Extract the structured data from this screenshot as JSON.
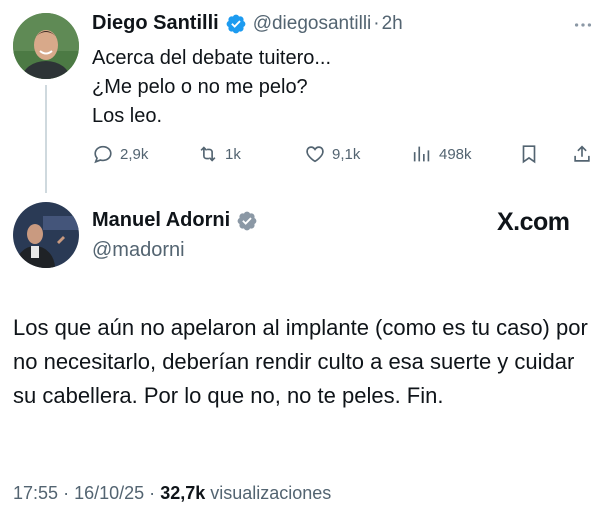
{
  "tweet": {
    "author_name": "Diego Santilli",
    "handle": "@diegosantilli",
    "separator": "·",
    "time": "2h",
    "text": "Acerca del debate tuitero...\n¿Me pelo o no me pelo?\nLos leo.",
    "more_icon": "more-dots-icon",
    "actions": {
      "replies": "2,9k",
      "retweets": "1k",
      "likes": "9,1k",
      "views": "498k"
    }
  },
  "reply": {
    "author_name": "Manuel Adorni",
    "handle": "@madorni",
    "site_label": "X.com",
    "text": "Los que aún no apelaron al implante (como es tu caso) por no necesitarlo, deberían rendir culto a esa suerte y cuidar su cabellera. Por lo que no, no te peles. Fin.",
    "time": "17:55",
    "date": "16/10/25",
    "views_count": "32,7k",
    "views_label": "visualizaciones",
    "separator": "·"
  },
  "colors": {
    "verified": "#1d9bf0",
    "muted": "#536471"
  }
}
